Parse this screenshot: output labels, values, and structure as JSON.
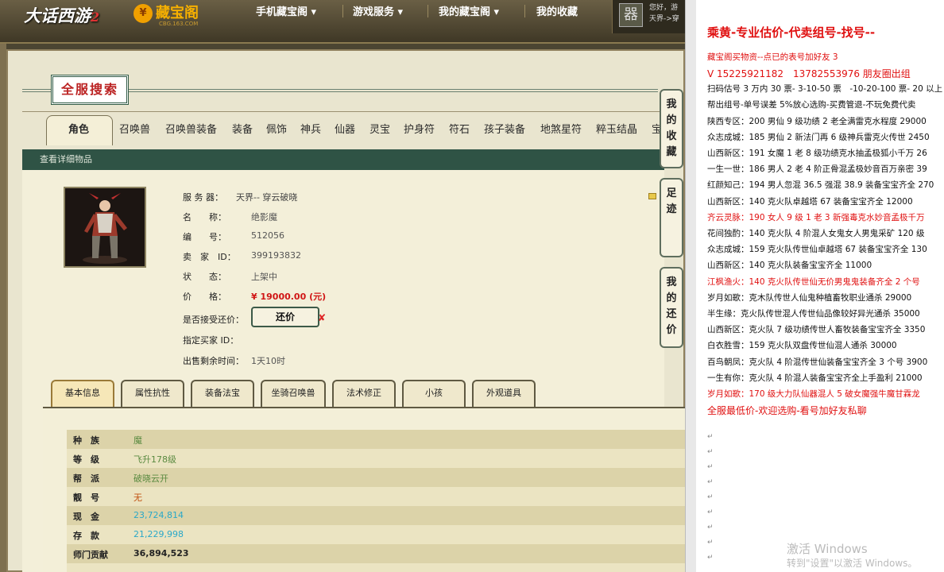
{
  "brand": {
    "game_logo": "大话西游",
    "game_logo_num": "2",
    "site_logo": "藏宝阁",
    "site_logo_sub": "CBG.163.COM"
  },
  "nav": {
    "items": [
      "手机藏宝阁 ▾",
      "游戏服务 ▾",
      "我的藏宝阁 ▾",
      "我的收藏"
    ]
  },
  "user": {
    "avatar_glyph": "器",
    "greeting": "您好，游",
    "server": "天界->穿"
  },
  "search": {
    "title": "全服搜索"
  },
  "category_tabs": [
    "角色",
    "召唤兽",
    "召唤兽装备",
    "装备",
    "佩饰",
    "神兵",
    "仙器",
    "灵宝",
    "护身符",
    "符石",
    "孩子装备",
    "地煞星符",
    "粹玉结晶",
    "宝"
  ],
  "detail_bar": "查看详细物品",
  "item": {
    "fields": [
      {
        "label": "服 务 器：",
        "value": "天界-- 穿云破晓"
      },
      {
        "label": "名　　称：",
        "value": "绝影魔"
      },
      {
        "label": "编　　号：",
        "value": "512056"
      },
      {
        "label": "卖　家　ID：",
        "value": "399193832"
      },
      {
        "label": "状　　态：",
        "value": "上架中"
      },
      {
        "label": "价　　格：",
        "value": "¥ 19000.00 (元)"
      },
      {
        "label": "是否接受还价：",
        "value": ""
      },
      {
        "label": "指定买家 ID：",
        "value": ""
      },
      {
        "label": "出售剩余时间：",
        "value": "1天10时"
      }
    ],
    "counter_offer_label": "还价",
    "counter_offer_x": "✘"
  },
  "info_tabs": [
    "基本信息",
    "属性抗性",
    "装备法宝",
    "坐骑召唤兽",
    "法术修正",
    "小孩",
    "外观道具"
  ],
  "basic_info": [
    {
      "key": "种　族",
      "value": "魔",
      "color": "#5a8a40"
    },
    {
      "key": "等　级",
      "value": "飞升178级",
      "color": "#5a8a40"
    },
    {
      "key": "帮　派",
      "value": "破晓云开",
      "color": "#5a8a40"
    },
    {
      "key": "靓　号",
      "value": "无",
      "color": "#c05010"
    },
    {
      "key": "现　金",
      "value": "23,724,814",
      "color": "#2aa8c8"
    },
    {
      "key": "存　款",
      "value": "21,229,998",
      "color": "#2aa8c8"
    },
    {
      "key": "师门贡献",
      "value": "36,894,523",
      "color": "#222"
    },
    {
      "key": "",
      "value": "",
      "color": "#222"
    }
  ],
  "side_buttons": [
    {
      "label": "我的收藏"
    },
    {
      "label": "足迹"
    },
    {
      "label": "我的还价"
    }
  ],
  "notepad": {
    "lines": [
      {
        "text": "乘黄-专业估价-代卖组号-找号--",
        "color": "red",
        "size": 15,
        "bold": true
      },
      {
        "text": "藏宝阁买物资--点已的表号加好友 3 ",
        "color": "red"
      },
      {
        "text": "V 15225921182　13782553976 朋友圈出组",
        "color": "red",
        "size": 12
      },
      {
        "text": "扫码估号 3 万内 30 票- 3-10-50 票　-10-20-100 票- 20 以上"
      },
      {
        "text": "帮出组号-单号误差 5%放心选购-买费管退-不玩免费代卖"
      },
      {
        "text": "陕西专区：200 男仙 9 级功绩 2 老全满雷克水程度 29000"
      },
      {
        "text": "众志成城：185 男仙 2 新法门再 6 级神兵雷克火传世 2450"
      },
      {
        "text": "山西新区：191 女魔 1 老 8 级功绩克水抽孟极狐小千万 26"
      },
      {
        "text": "一生一世：186 男人 2 老 4 阶正骨混孟极妙音百万亲密 39"
      },
      {
        "text": "红颜知己：194 男人忽混 36.5 强混 38.9 装备宝宝齐全 270"
      },
      {
        "text": "山西新区：140 克火队卓越塔 67 装备宝宝齐全 12000"
      },
      {
        "text": "齐云灵脉：190 女人 9 级 1 老 3 新强毒克水妙音孟极千万",
        "color": "red"
      },
      {
        "text": "花间独酌：140 克火队 4 阶混人女鬼女人男鬼采矿 120 级"
      },
      {
        "text": "众志成城：159 克火队传世仙卓越塔 67 装备宝宝齐全 130"
      },
      {
        "text": "山西新区：140 克火队装备宝宝齐全 11000"
      },
      {
        "text": "江枫渔火：140 克火队传世仙无价男鬼鬼装备齐全 2 个号",
        "color": "red"
      },
      {
        "text": "岁月如歌：克木队传世人仙鬼种植畜牧职业通杀 29000"
      },
      {
        "text": "半生缘：克火队传世混人传世仙品像较好异光通杀 35000"
      },
      {
        "text": "山西新区：克火队 7 级功绩传世人畜牧装备宝宝齐全 3350"
      },
      {
        "text": "白衣胜雪：159 克火队双盘传世仙混人通杀 30000"
      },
      {
        "text": "百鸟朝凤：克火队 4 阶混传世仙装备宝宝齐全 3 个号 3900"
      },
      {
        "text": "一生有你：克火队 4 阶混人装备宝宝齐全上手盈利 21000"
      },
      {
        "text": "岁月如歌：170 级大力队仙器混人 5 破女魔强牛魔甘霖龙",
        "color": "red"
      },
      {
        "text": "全服最低价-欢迎选购-看号加好友私聊",
        "color": "red",
        "size": 12
      }
    ],
    "return_mark": "↵"
  },
  "watermark": {
    "line1": "激活 Windows",
    "line2": "转到\"设置\"以激活 Windows。"
  }
}
